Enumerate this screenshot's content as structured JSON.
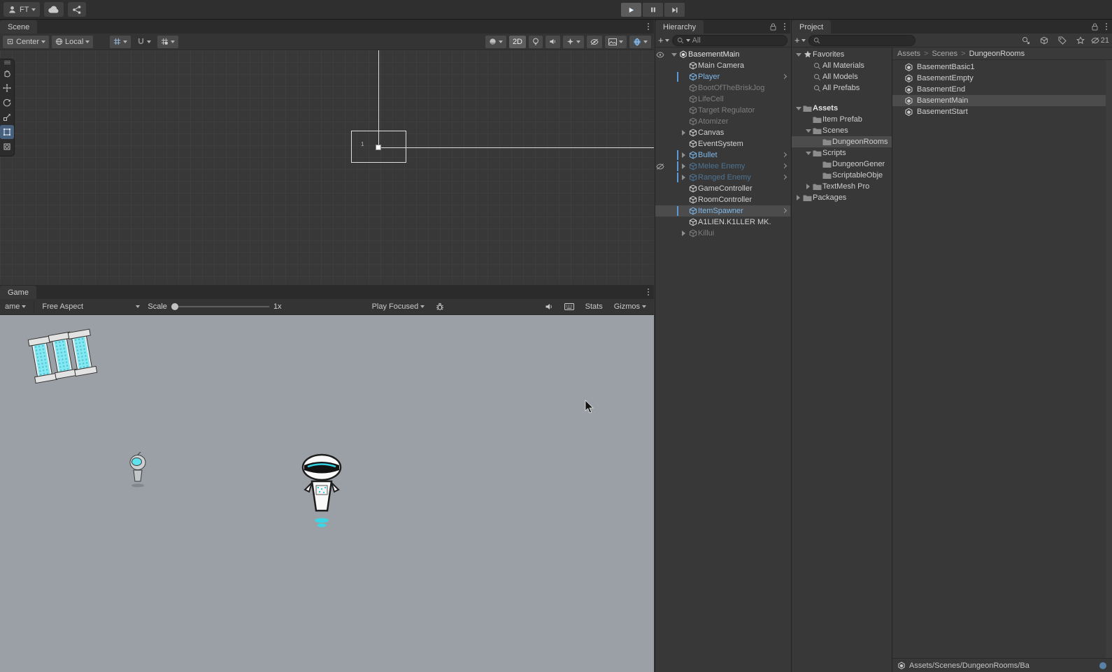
{
  "topbar": {
    "account_label": "FT"
  },
  "scene": {
    "tab": "Scene",
    "toolbar": {
      "pivot_label": "Center",
      "orientation_label": "Local",
      "mode_2d_label": "2D"
    },
    "viewport": {
      "room_label": "1"
    },
    "tools": [
      "view",
      "move",
      "rotate",
      "scale",
      "rect",
      "transform"
    ]
  },
  "game": {
    "tab": "Game",
    "toolbar": {
      "display_label": "ame",
      "aspect_label": "Free Aspect",
      "scale_label": "Scale",
      "scale_value": "1x",
      "focus_label": "Play Focused",
      "stats_label": "Stats",
      "gizmos_label": "Gizmos"
    }
  },
  "hierarchy": {
    "tab": "Hierarchy",
    "add_label": "+",
    "search_scope": "All",
    "items": [
      {
        "label": "BasementMain",
        "icon": "unity",
        "depth": 0,
        "expand": "down",
        "style": "scene",
        "vis": "eye"
      },
      {
        "label": "Main Camera",
        "icon": "cube",
        "depth": 1,
        "style": "normal"
      },
      {
        "label": "Player",
        "icon": "cube",
        "depth": 1,
        "style": "prefab",
        "chevron": true,
        "bar": true
      },
      {
        "label": "BootOfTheBriskJog",
        "icon": "cube",
        "depth": 1,
        "style": "inactive"
      },
      {
        "label": "LifeCell",
        "icon": "cube",
        "depth": 1,
        "style": "inactive"
      },
      {
        "label": "Target Regulator",
        "icon": "cube",
        "depth": 1,
        "style": "inactive"
      },
      {
        "label": "Atomizer",
        "icon": "cube",
        "depth": 1,
        "style": "inactive"
      },
      {
        "label": "Canvas",
        "icon": "cube",
        "depth": 1,
        "expand": "right",
        "style": "normal"
      },
      {
        "label": "EventSystem",
        "icon": "cube",
        "depth": 1,
        "style": "normal"
      },
      {
        "label": "Bullet",
        "icon": "cube",
        "depth": 1,
        "expand": "right",
        "style": "prefab",
        "chevron": true,
        "bar": true
      },
      {
        "label": "Melee Enemy",
        "icon": "cube",
        "depth": 1,
        "expand": "right",
        "style": "prefab-inactive",
        "chevron": true,
        "bar": true,
        "vis": "eye-off"
      },
      {
        "label": "Ranged Enemy",
        "icon": "cube",
        "depth": 1,
        "expand": "right",
        "style": "prefab-inactive",
        "chevron": true,
        "bar": true
      },
      {
        "label": "GameController",
        "icon": "cube",
        "depth": 1,
        "style": "normal"
      },
      {
        "label": "RoomController",
        "icon": "cube",
        "depth": 1,
        "style": "normal"
      },
      {
        "label": "ItemSpawner",
        "icon": "cube",
        "depth": 1,
        "style": "prefab",
        "chevron": true,
        "bar": true,
        "selected": true
      },
      {
        "label": "A1LIEN.K1LLER MK.",
        "icon": "cube",
        "depth": 1,
        "style": "normal"
      },
      {
        "label": "Killui",
        "icon": "cube",
        "depth": 1,
        "expand": "right",
        "style": "inactive"
      }
    ]
  },
  "project": {
    "tab": "Project",
    "add_label": "+",
    "search_value": "",
    "hidden_count": "21",
    "tree": [
      {
        "label": "Favorites",
        "icon": "star",
        "depth": 0,
        "expand": "down"
      },
      {
        "label": "All Materials",
        "icon": "search",
        "depth": 1
      },
      {
        "label": "All Models",
        "icon": "search",
        "depth": 1
      },
      {
        "label": "All Prefabs",
        "icon": "search",
        "depth": 1
      },
      {
        "spacer": true
      },
      {
        "label": "Assets",
        "icon": "folder",
        "depth": 0,
        "expand": "down",
        "bold": true
      },
      {
        "label": "Item Prefab",
        "icon": "folder",
        "depth": 1
      },
      {
        "label": "Scenes",
        "icon": "folder",
        "depth": 1,
        "expand": "down"
      },
      {
        "label": "DungeonRooms",
        "icon": "folder",
        "depth": 2,
        "selected": true
      },
      {
        "label": "Scripts",
        "icon": "folder",
        "depth": 1,
        "expand": "down"
      },
      {
        "label": "DungeonGener",
        "icon": "folder",
        "depth": 2
      },
      {
        "label": "ScriptableObje",
        "icon": "folder",
        "depth": 2
      },
      {
        "label": "TextMesh Pro",
        "icon": "folder",
        "depth": 1,
        "expand": "right"
      },
      {
        "label": "Packages",
        "icon": "folder",
        "depth": 0,
        "expand": "right"
      }
    ],
    "breadcrumb": [
      "Assets",
      "Scenes",
      "DungeonRooms"
    ],
    "files": [
      {
        "label": "BasementBasic1"
      },
      {
        "label": "BasementEmpty"
      },
      {
        "label": "BasementEnd"
      },
      {
        "label": "BasementMain",
        "selected": true
      },
      {
        "label": "BasementStart"
      }
    ],
    "status_path": "Assets/Scenes/DungeonRooms/Ba"
  }
}
